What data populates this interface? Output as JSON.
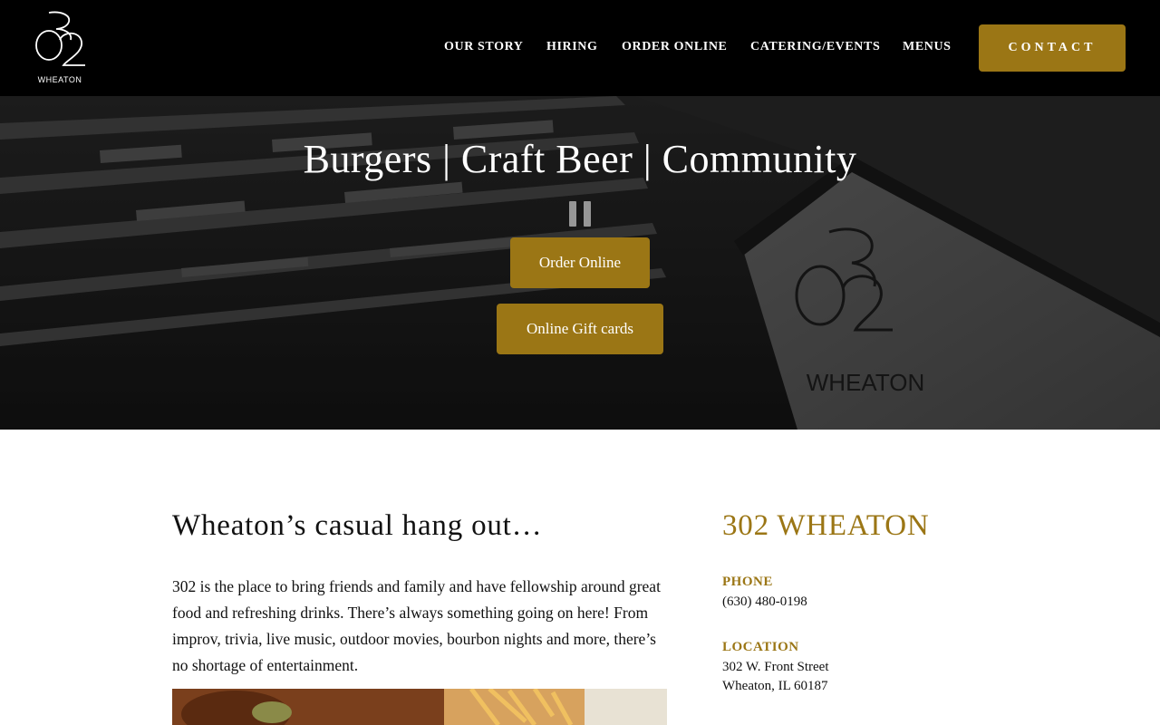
{
  "header": {
    "logo_text": "WHEATON",
    "nav": [
      {
        "label": "OUR STORY"
      },
      {
        "label": "HIRING"
      },
      {
        "label": "ORDER ONLINE"
      },
      {
        "label": "CATERING/EVENTS"
      },
      {
        "label": "MENUS"
      }
    ],
    "contact_label": "CONTACT"
  },
  "hero": {
    "title": "Burgers | Craft Beer | Community",
    "order_button": "Order Online",
    "gift_button": "Online Gift cards",
    "building_sign": "WHEATON"
  },
  "intro": {
    "heading": "Wheaton’s casual hang out…",
    "text": "302 is the place to bring friends and family and have fellowship around great food and refreshing drinks. There’s always something going on here! From improv, trivia, live music, outdoor movies, bourbon nights and more, there’s no shortage of entertainment."
  },
  "sidebar": {
    "title": "302 WHEATON",
    "phone_label": "PHONE",
    "phone": "(630) 480-0198",
    "location_label": "LOCATION",
    "address_line1": "302 W. Front Street",
    "address_line2": "Wheaton, IL 60187"
  },
  "colors": {
    "accent": "#9b7615",
    "header_bg": "#000000"
  }
}
